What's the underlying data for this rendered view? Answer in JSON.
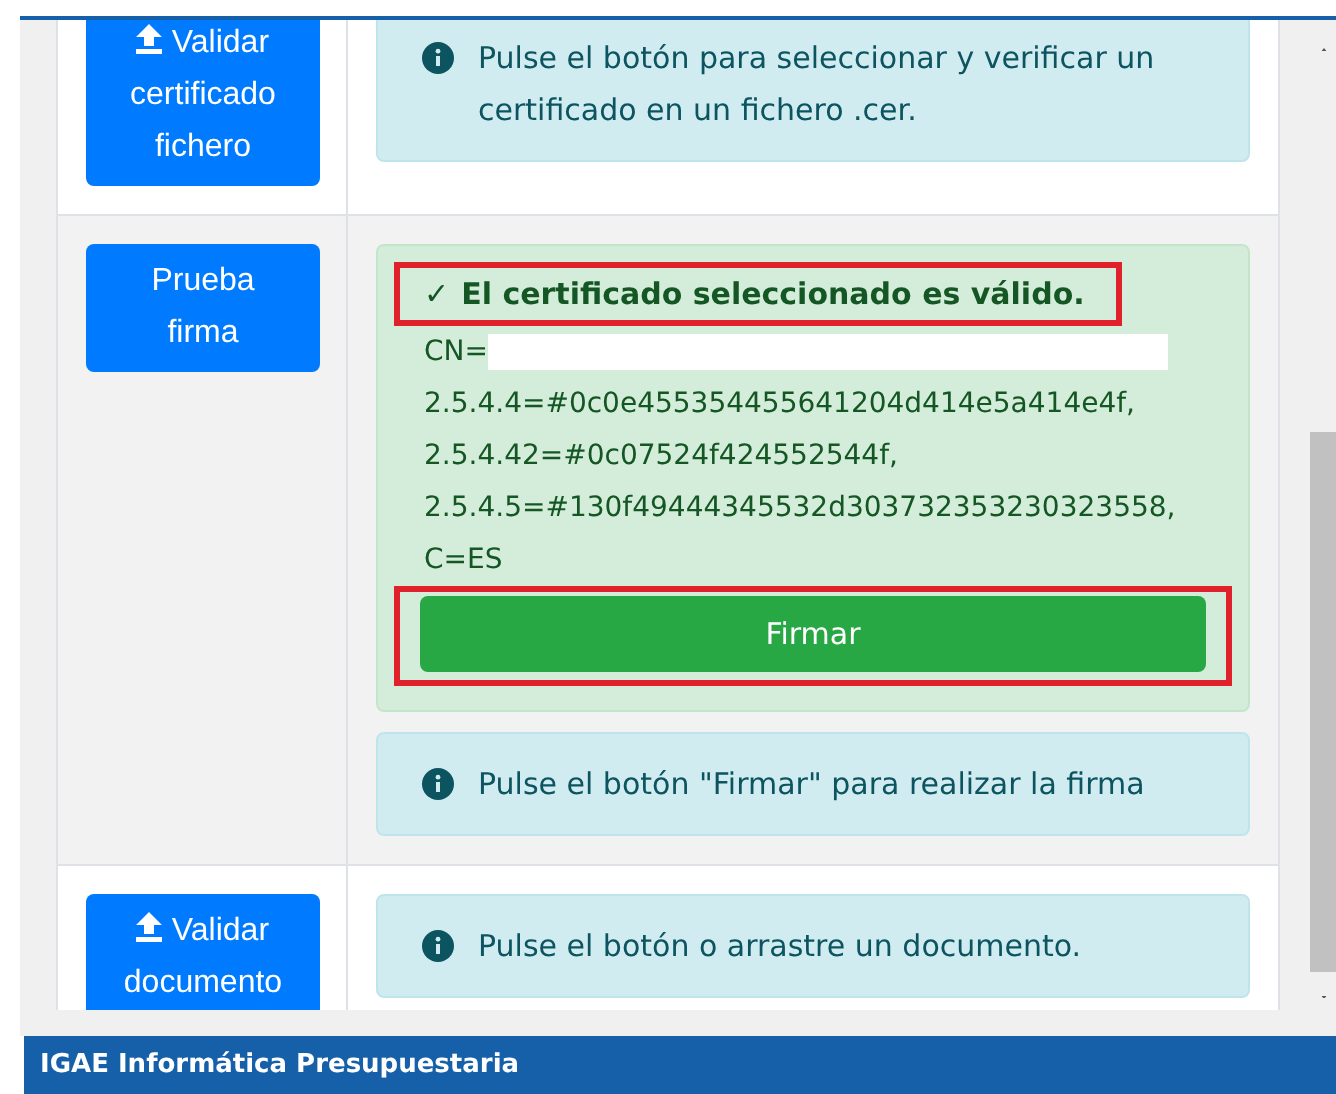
{
  "rows": [
    {
      "shaded": false,
      "button": {
        "upload_icon": true,
        "label": "Validar certificado fichero"
      },
      "panels": [
        {
          "kind": "info",
          "text": "Pulse el botón para seleccionar y verificar un certificado en un fichero .cer."
        }
      ]
    },
    {
      "shaded": true,
      "button": {
        "upload_icon": false,
        "label": "Prueba firma"
      },
      "panels": [
        {
          "kind": "success",
          "check": "✓",
          "heading": "El certificado seleccionado es válido.",
          "heading_highlighted": true,
          "redacted": true,
          "lines": [
            "CN=",
            "2.5.4.4=#0c0e455354455641204d414e5a414e4f,",
            "2.5.4.42=#0c07524f424552544f,",
            "2.5.4.5=#130f49444345532d303732353230323558,",
            "C=ES"
          ],
          "action": {
            "label": "Firmar",
            "highlighted": true
          }
        },
        {
          "kind": "info",
          "text": "Pulse el botón \"Firmar\" para realizar la firma"
        }
      ]
    },
    {
      "shaded": false,
      "button": {
        "upload_icon": true,
        "label": "Validar documento"
      },
      "panels": [
        {
          "kind": "info",
          "text": "Pulse el botón o arrastre un documento."
        }
      ]
    }
  ],
  "footer": "IGAE Informática Presupuestaria"
}
